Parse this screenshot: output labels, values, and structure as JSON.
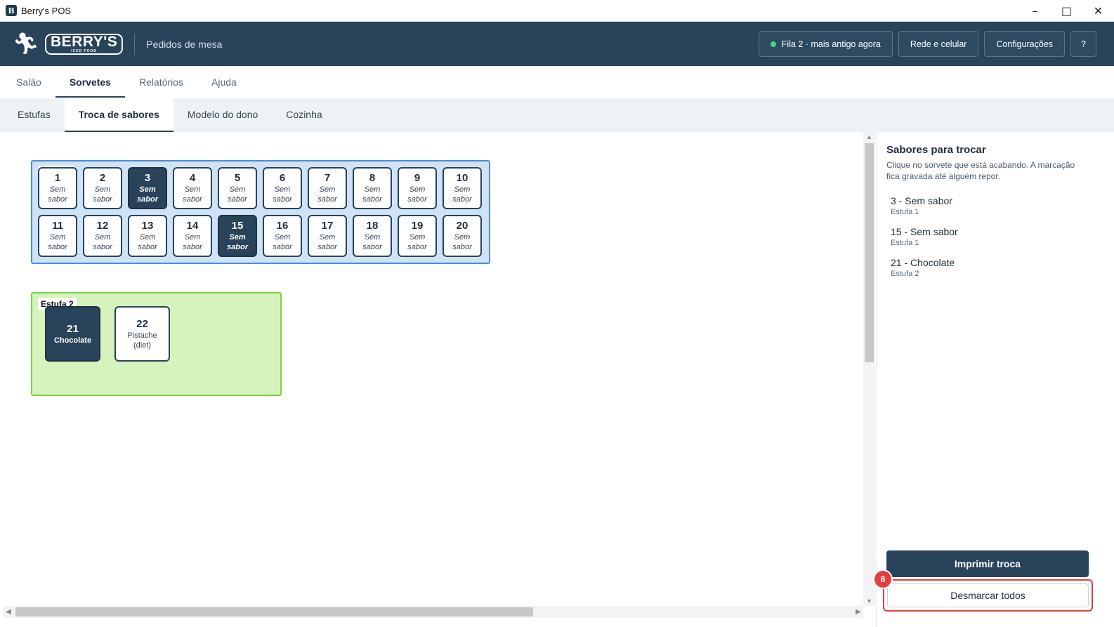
{
  "window": {
    "title": "Berry's POS",
    "app_icon": "B"
  },
  "header": {
    "logo_text": "BERRY'S",
    "logo_sub": "ICED FOOD",
    "page": "Pedidos de mesa",
    "status_label": "Fila 2 · mais antigo agora",
    "status_color": "#4cd47d",
    "network_label": "Rede e celular",
    "settings_label": "Configurações",
    "help_label": "?"
  },
  "tabs": [
    {
      "label": "Salão"
    },
    {
      "label": "Sorvetes"
    },
    {
      "label": "Relatórios"
    },
    {
      "label": "Ajuda"
    }
  ],
  "subtabs": [
    {
      "label": "Estufas"
    },
    {
      "label": "Troca de sabores"
    },
    {
      "label": "Modelo do dono"
    },
    {
      "label": "Cozinha"
    }
  ],
  "estufa1": {
    "label": "",
    "pots": [
      {
        "num": "1",
        "flavor": "Sem sabor",
        "selected": false
      },
      {
        "num": "2",
        "flavor": "Sem sabor",
        "selected": false
      },
      {
        "num": "3",
        "flavor": "Sem sabor",
        "selected": true
      },
      {
        "num": "4",
        "flavor": "Sem sabor",
        "selected": false
      },
      {
        "num": "5",
        "flavor": "Sem sabor",
        "selected": false
      },
      {
        "num": "6",
        "flavor": "Sem sabor",
        "selected": false
      },
      {
        "num": "7",
        "flavor": "Sem sabor",
        "selected": false
      },
      {
        "num": "8",
        "flavor": "Sem sabor",
        "selected": false
      },
      {
        "num": "9",
        "flavor": "Sem sabor",
        "selected": false
      },
      {
        "num": "10",
        "flavor": "Sem sabor",
        "selected": false
      },
      {
        "num": "11",
        "flavor": "Sem sabor",
        "selected": false
      },
      {
        "num": "12",
        "flavor": "Sem sabor",
        "selected": false
      },
      {
        "num": "13",
        "flavor": "Sem sabor",
        "selected": false
      },
      {
        "num": "14",
        "flavor": "Sem sabor",
        "selected": false
      },
      {
        "num": "15",
        "flavor": "Sem sabor",
        "selected": true
      },
      {
        "num": "16",
        "flavor": "Sem sabor",
        "selected": false
      },
      {
        "num": "17",
        "flavor": "Sem sabor",
        "selected": false
      },
      {
        "num": "18",
        "flavor": "Sem sabor",
        "selected": false
      },
      {
        "num": "19",
        "flavor": "Sem sabor",
        "selected": false
      },
      {
        "num": "20",
        "flavor": "Sem sabor",
        "selected": false
      }
    ]
  },
  "estufa2": {
    "label": "Estufa 2",
    "pots": [
      {
        "num": "21",
        "flavor": "Chocolate",
        "selected": true
      },
      {
        "num": "22",
        "flavor": "Pistache (diet)",
        "selected": false
      }
    ]
  },
  "panel": {
    "title": "Sabores para trocar",
    "description": "Clique no sorvete que está acabando. A marcação fica gravada até alguém repor.",
    "items": [
      {
        "name": "3 - Sem sabor",
        "location": "Estufa 1"
      },
      {
        "name": "15 - Sem sabor",
        "location": "Estufa 1"
      },
      {
        "name": "21 - Chocolate",
        "location": "Estufa 2"
      }
    ],
    "print_label": "Imprimir troca",
    "clear_label": "Desmarcar todos",
    "badge": "8"
  },
  "colors": {
    "header_bg": "#28435a",
    "selected_pot": "#28435a",
    "estufa1_bg": "#cfe2f6",
    "estufa2_bg": "#d6f2bd",
    "highlight": "#e2403f"
  }
}
